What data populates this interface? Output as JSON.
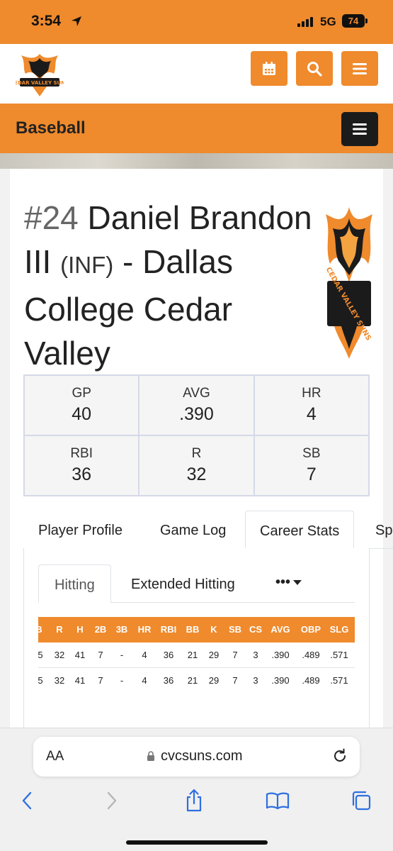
{
  "status_bar": {
    "time": "3:54",
    "network": "5G",
    "battery": "74"
  },
  "header": {
    "logo_text": "CEDAR VALLEY SUNS",
    "icons": [
      "calendar-icon",
      "search-icon",
      "menu-icon"
    ]
  },
  "sport": {
    "title": "Baseball"
  },
  "player": {
    "number": "#24",
    "name": "Daniel Brandon III",
    "position": "(INF)",
    "team": "- Dallas College Cedar Valley"
  },
  "summary_stats": [
    {
      "label": "GP",
      "value": "40"
    },
    {
      "label": "AVG",
      "value": ".390"
    },
    {
      "label": "HR",
      "value": "4"
    },
    {
      "label": "RBI",
      "value": "36"
    },
    {
      "label": "R",
      "value": "32"
    },
    {
      "label": "SB",
      "value": "7"
    }
  ],
  "tabs": [
    "Player Profile",
    "Game Log",
    "Career Stats",
    "Sp"
  ],
  "active_tab": "Career Stats",
  "subtabs": [
    "Hitting",
    "Extended Hitting",
    "•••"
  ],
  "stats_table": {
    "headers": [
      "B",
      "R",
      "H",
      "2B",
      "3B",
      "HR",
      "RBI",
      "BB",
      "K",
      "SB",
      "CS",
      "AVG",
      "OBP",
      "SLG"
    ],
    "rows": [
      [
        "5",
        "32",
        "41",
        "7",
        "-",
        "4",
        "36",
        "21",
        "29",
        "7",
        "3",
        ".390",
        ".489",
        ".571"
      ],
      [
        "5",
        "32",
        "41",
        "7",
        "-",
        "4",
        "36",
        "21",
        "29",
        "7",
        "3",
        ".390",
        ".489",
        ".571"
      ]
    ]
  },
  "browser": {
    "text_size_label": "AA",
    "url": "cvcsuns.com"
  },
  "colors": {
    "accent": "#ef8a2d",
    "dark": "#1b1b1b"
  }
}
